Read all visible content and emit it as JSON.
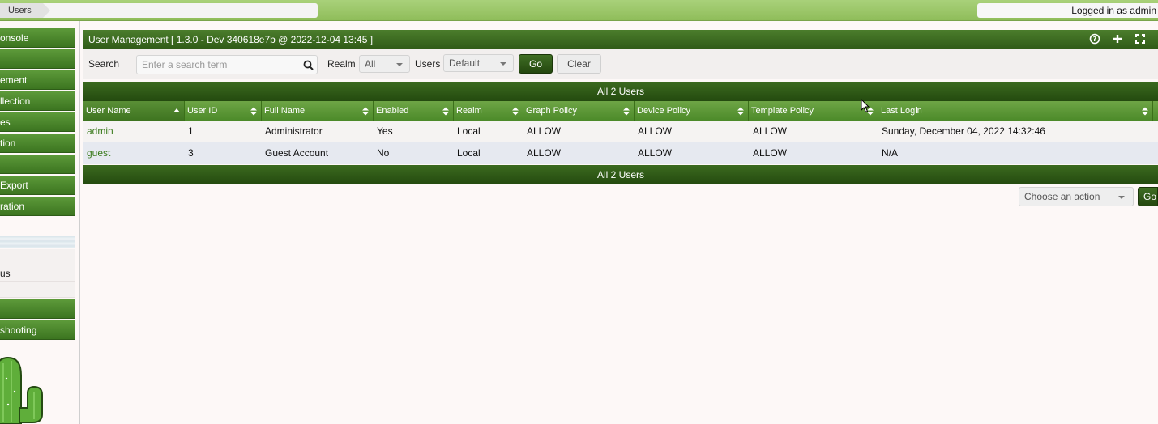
{
  "breadcrumb": {
    "item": "Users"
  },
  "header": {
    "login_status": "Logged in as admin"
  },
  "sidebar": {
    "items": [
      "onsole",
      "",
      "ement",
      "llection",
      "es",
      "tion",
      "",
      "Export",
      "ration"
    ],
    "sub_items": [
      "us"
    ],
    "bottom_items": [
      "",
      "shooting"
    ]
  },
  "panel": {
    "title": "User Management [ 1.3.0 - Dev 340618e7b @ 2022-12-04 13:45 ]",
    "icons": [
      "help-icon",
      "add-icon",
      "fullscreen-icon"
    ]
  },
  "filter": {
    "search_label": "Search",
    "search_placeholder": "Enter a search term",
    "realm_label": "Realm",
    "realm_value": "All",
    "users_label": "Users",
    "users_value": "Default",
    "go_label": "Go",
    "clear_label": "Clear"
  },
  "table": {
    "top_caption": "All 2 Users",
    "bottom_caption": "All 2 Users",
    "columns": [
      "User Name",
      "User ID",
      "Full Name",
      "Enabled",
      "Realm",
      "Graph Policy",
      "Device Policy",
      "Template Policy",
      "Last Login"
    ],
    "rows": [
      [
        "admin",
        "1",
        "Administrator",
        "Yes",
        "Local",
        "ALLOW",
        "ALLOW",
        "ALLOW",
        "Sunday, December 04, 2022 14:32:46"
      ],
      [
        "guest",
        "3",
        "Guest Account",
        "No",
        "Local",
        "ALLOW",
        "ALLOW",
        "ALLOW",
        "N/A"
      ]
    ]
  },
  "actions": {
    "placeholder": "Choose an action",
    "go_label": "Go"
  },
  "colors": {
    "accent": "#3b6a1f",
    "topbar": "#a9d17a",
    "link": "#3a7a1c"
  }
}
